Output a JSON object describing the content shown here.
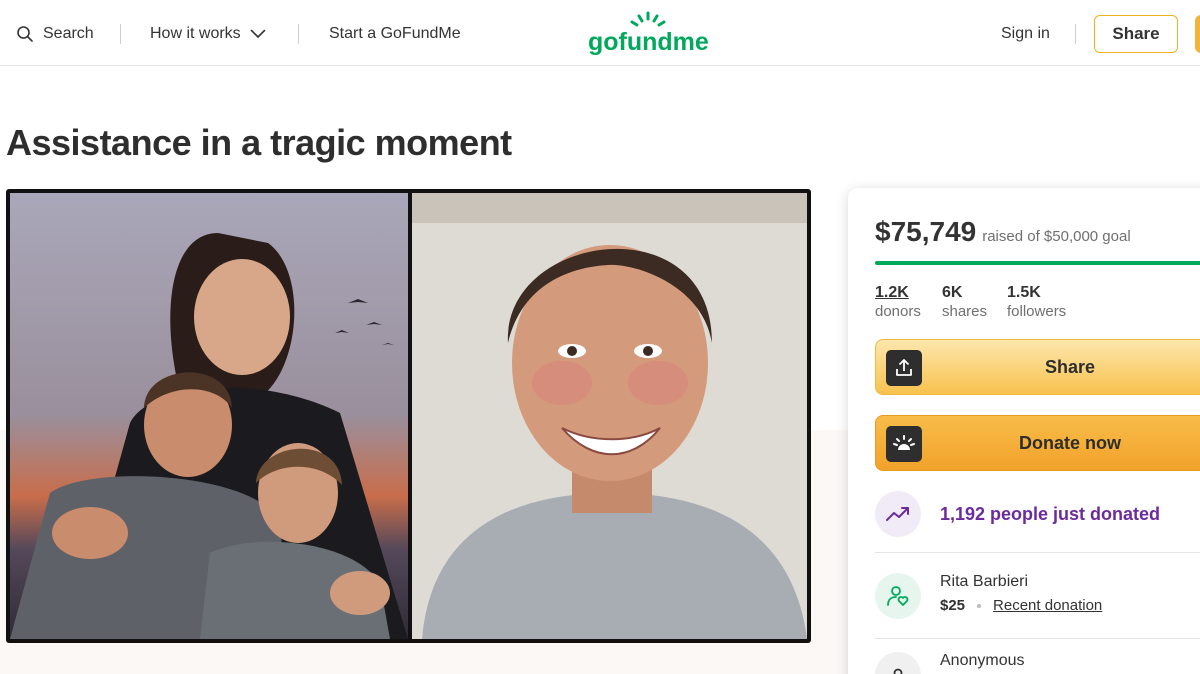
{
  "header": {
    "search_label": "Search",
    "how_it_works_label": "How it works",
    "start_label": "Start a GoFundMe",
    "logo_text": "gofundme",
    "sign_in_label": "Sign in",
    "share_label": "Share"
  },
  "campaign": {
    "title": "Assistance in a tragic moment"
  },
  "card": {
    "raised_amount": "$75,749",
    "raised_goal_text": "raised of $50,000 goal",
    "progress_fraction": 1.0,
    "stats": [
      {
        "value": "1.2K",
        "label": "donors"
      },
      {
        "value": "6K",
        "label": "shares"
      },
      {
        "value": "1.5K",
        "label": "followers"
      }
    ],
    "share_button_label": "Share",
    "donate_button_label": "Donate now",
    "trend_text": "1,192 people just donated",
    "donations": [
      {
        "name": "Rita Barbieri",
        "amount": "$25",
        "tag": "Recent donation"
      },
      {
        "name": "Anonymous"
      }
    ]
  },
  "colors": {
    "brand_green": "#02a95c",
    "accent_yellow": "#f2a22b",
    "trend_purple": "#6b2a9e"
  },
  "icons": {
    "search": "search-icon",
    "chevron": "chevron-down-icon",
    "share": "share-upload-icon",
    "donate": "donate-sun-icon",
    "trend": "trending-up-icon",
    "donor": "donor-heart-icon",
    "anonymous": "user-icon"
  }
}
